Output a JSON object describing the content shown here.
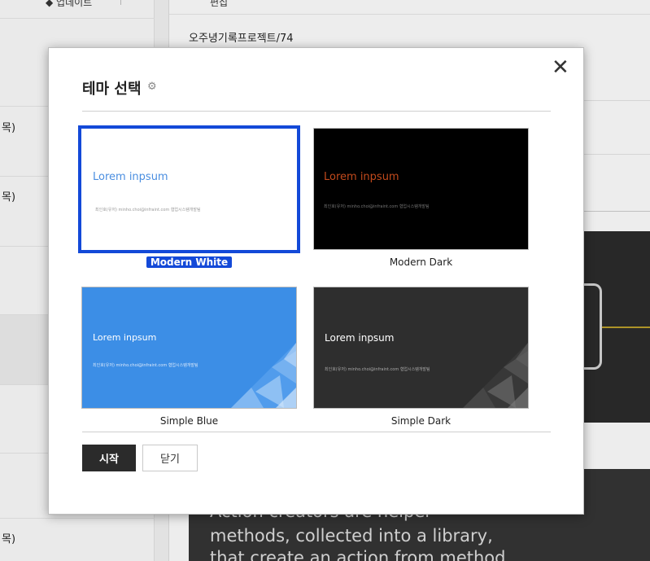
{
  "background": {
    "left_header": "◆ 업데이트 ˅",
    "left_items": [
      "목)",
      "목)",
      "목)"
    ],
    "right_header": "편집",
    "right_path": "오주녕기록프로젝트/74",
    "dark_text_lines": [
      "Action creators are helper",
      "methods, collected into a library,",
      "that create an action from method"
    ]
  },
  "modal": {
    "title": "테마 선택",
    "settings_icon": "gear-icon",
    "close_icon": "✕",
    "themes": [
      {
        "name": "Modern White",
        "heading": "Lorem inpsum",
        "subline": "최인호(유저) minho.choi@infraint.com 협업시스템개발팀",
        "selected": true
      },
      {
        "name": "Modern Dark",
        "heading": "Lorem inpsum",
        "subline": "최인호(유저) minho.choi@infraint.com 협업시스템개발팀",
        "selected": false
      },
      {
        "name": "Simple Blue",
        "heading": "Lorem inpsum",
        "subline": "최인호(유저) minho.choi@infraint.com 협업시스템개발팀",
        "selected": false
      },
      {
        "name": "Simple Dark",
        "heading": "Lorem inpsum",
        "subline": "최인호(유저) minho.choi@infraint.com 협업시스템개발팀",
        "selected": false
      }
    ],
    "start_button": "시작",
    "close_button": "닫기"
  },
  "colors": {
    "selection_accent": "#1349d8",
    "start_button_bg": "#2b2b2b",
    "simple_blue": "#3c8ee6",
    "modern_dark": "#000000",
    "simple_dark": "#2e2e2e"
  }
}
